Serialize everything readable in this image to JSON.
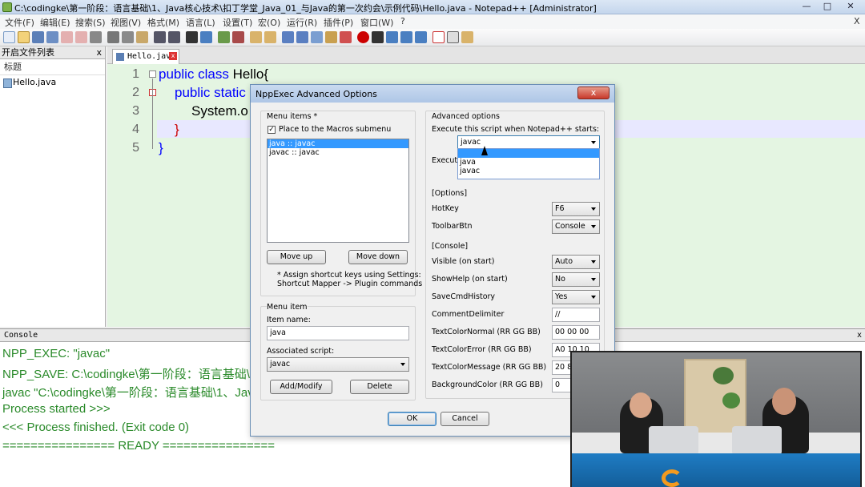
{
  "window": {
    "title": "C:\\codingke\\第一阶段：语言基础\\1、Java核心技术\\扣丁学堂_Java_01_与Java的第一次约会\\示例代码\\Hello.java - Notepad++ [Administrator]"
  },
  "menu": [
    "文件(F)",
    "编辑(E)",
    "搜索(S)",
    "视图(V)",
    "格式(M)",
    "语言(L)",
    "设置(T)",
    "宏(O)",
    "运行(R)",
    "插件(P)",
    "窗口(W)",
    "?"
  ],
  "menu_close": "X",
  "filelist": {
    "title": "开启文件列表",
    "close": "x",
    "column": "标题",
    "files": [
      "Hello.java"
    ]
  },
  "tab": {
    "label": "Hello.java",
    "close": "x"
  },
  "editor": {
    "line_numbers": [
      "1",
      "2",
      "3",
      "4",
      "5"
    ],
    "lines": [
      {
        "kw": "public class",
        "text": " Hello{"
      },
      {
        "kw": "public static",
        "text": ""
      },
      {
        "kw": "",
        "text": "System.o"
      },
      {
        "kw": "",
        "text": "}"
      },
      {
        "kw": "",
        "text": "}"
      }
    ]
  },
  "console": {
    "title": "Console",
    "close": "x",
    "lines": [
      "NPP_EXEC: \"javac\"",
      "NPP_SAVE: C:\\codingke\\第一阶段：语言基础\\1、",
      "javac \"C:\\codingke\\第一阶段：语言基础\\1、Java核",
      "Process started >>>",
      "<<< Process finished. (Exit code 0)",
      "================ READY ================"
    ]
  },
  "dialog": {
    "title": "NppExec Advanced Options",
    "close": "x",
    "menu_items": {
      "group": "Menu items *",
      "place_macros": "Place to the Macros submenu",
      "items": [
        "java :: javac",
        "javac :: javac"
      ],
      "move_up": "Move up",
      "move_down": "Move down",
      "note_1": "* Assign shortcut keys using Settings:",
      "note_2": "Shortcut Mapper -> Plugin commands"
    },
    "menu_item": {
      "group": "Menu item",
      "item_name_label": "Item name:",
      "item_name_value": "java",
      "assoc_label": "Associated script:",
      "assoc_value": "javac",
      "add_modify": "Add/Modify",
      "delete": "Delete"
    },
    "advanced": {
      "group": "Advanced options",
      "exec_label": "Execute this script when Notepad++ starts:",
      "exec_value": "javac",
      "dropdown_options": [
        "",
        "java",
        "javac"
      ],
      "execute_label": "Execute",
      "options_group": "[Options]",
      "hotkey_label": "HotKey",
      "hotkey_value": "F6",
      "toolbar_label": "ToolbarBtn",
      "toolbar_value": "Console",
      "console_group": "[Console]",
      "visible_label": "Visible (on start)",
      "visible_value": "Auto",
      "showhelp_label": "ShowHelp (on start)",
      "showhelp_value": "No",
      "savecmd_label": "SaveCmdHistory",
      "savecmd_value": "Yes",
      "comment_label": "CommentDelimiter",
      "comment_value": "//",
      "tcnormal_label": "TextColorNormal (RR GG BB)",
      "tcnormal_value": "00 00 00",
      "tcerror_label": "TextColorError (RR GG BB)",
      "tcerror_value": "A0 10 10",
      "tcmsg_label": "TextColorMessage (RR GG BB)",
      "tcmsg_value": "20 8",
      "bg_label": "BackgroundColor (RR GG BB)",
      "bg_value": "0"
    },
    "ok": "OK",
    "cancel": "Cancel"
  }
}
